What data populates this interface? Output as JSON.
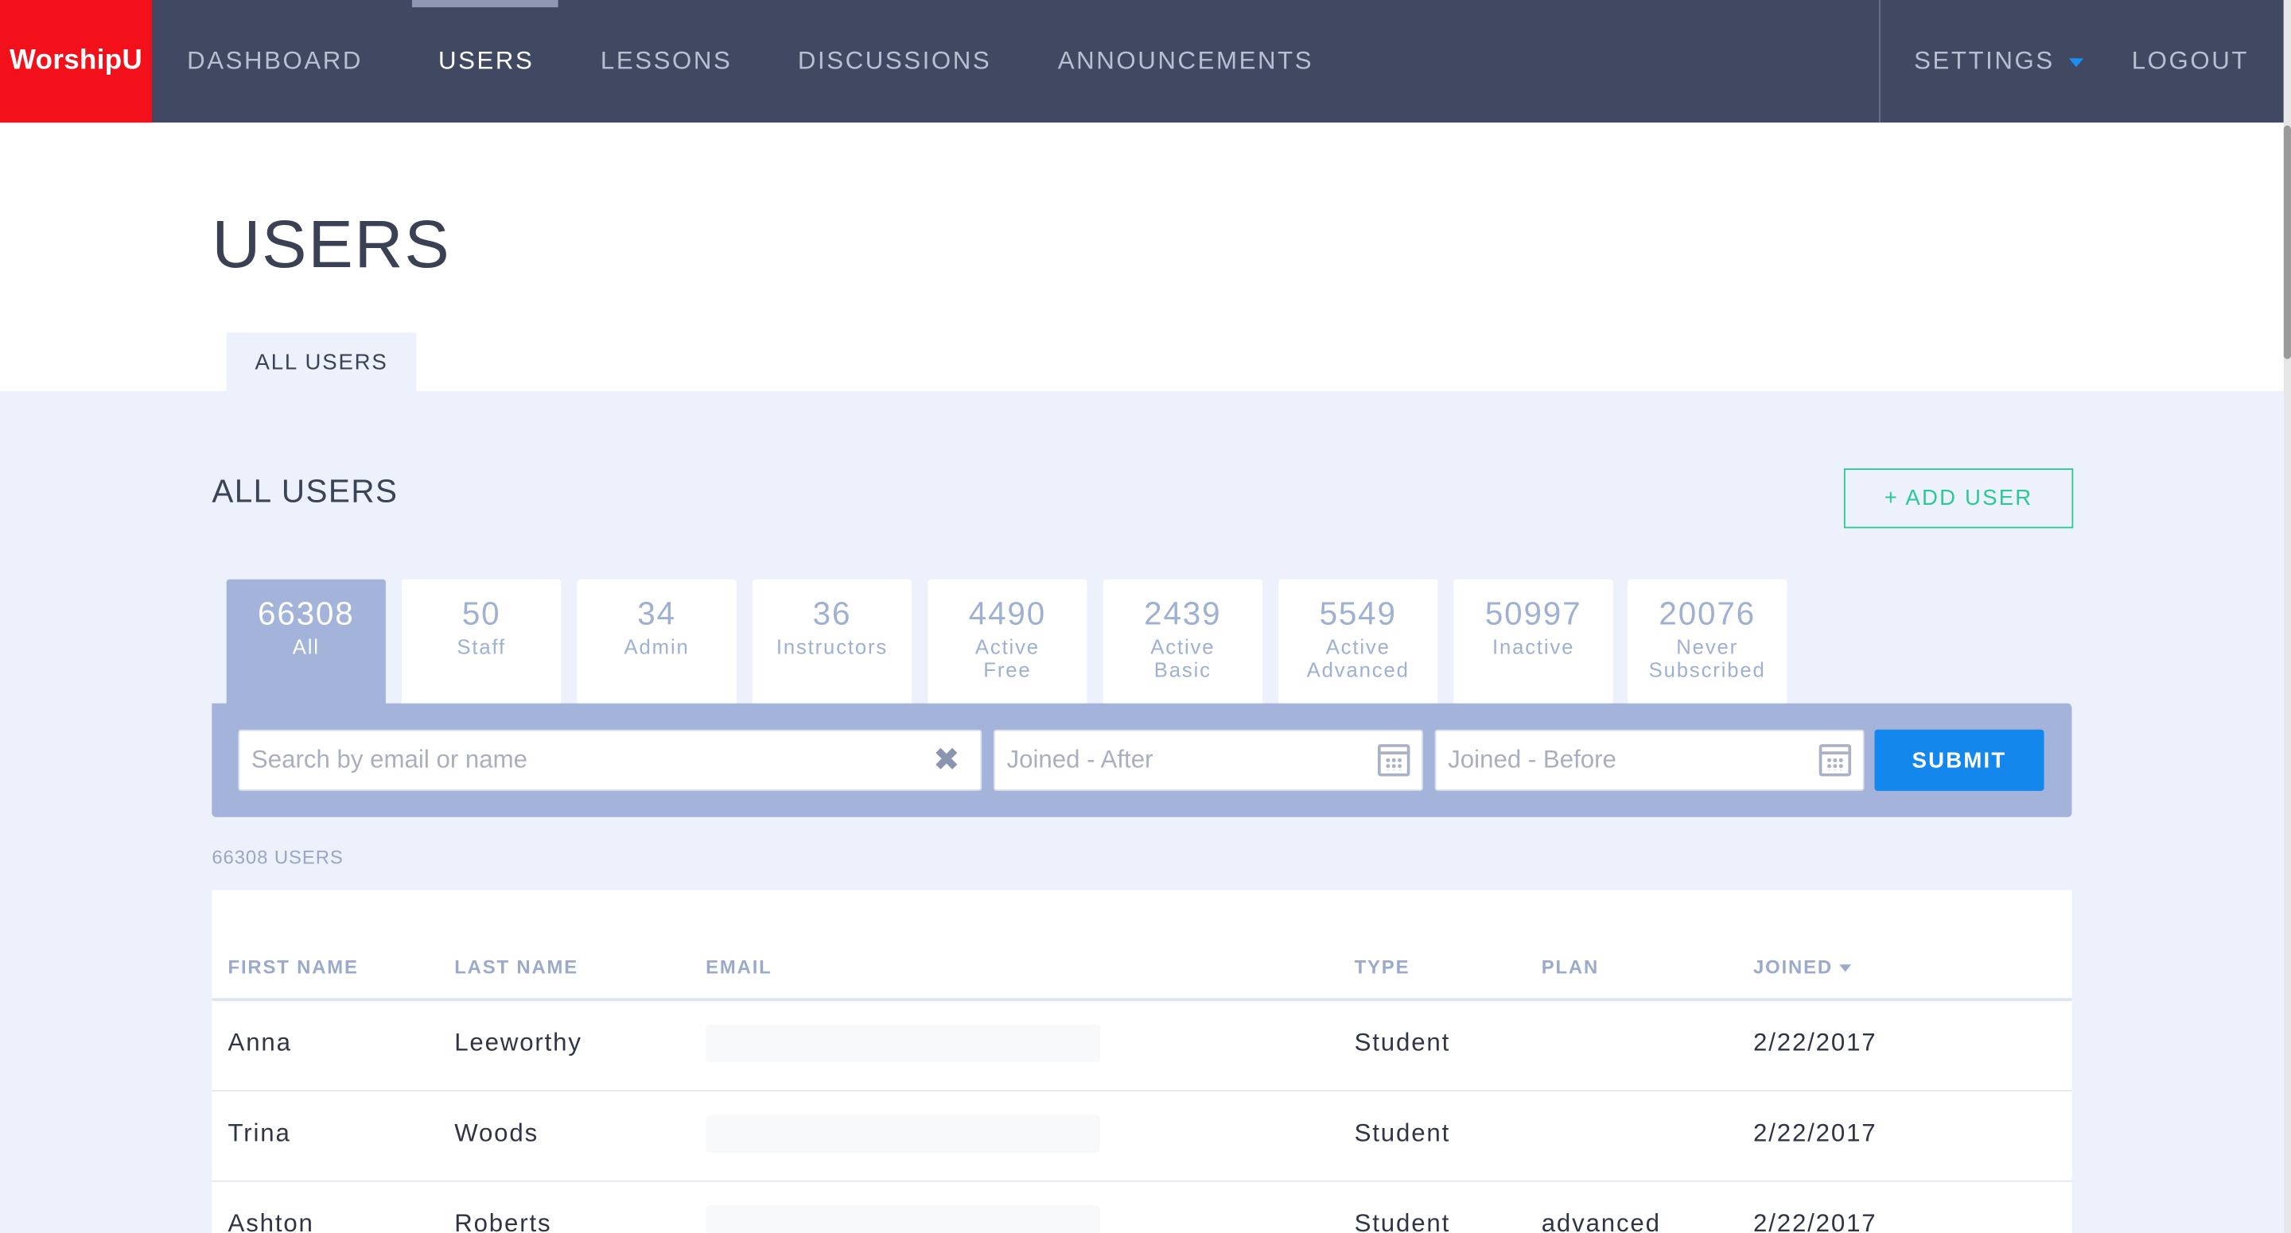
{
  "brand": "WorshipU",
  "nav": {
    "items": [
      {
        "label": "DASHBOARD"
      },
      {
        "label": "USERS"
      },
      {
        "label": "LESSONS"
      },
      {
        "label": "DISCUSSIONS"
      },
      {
        "label": "ANNOUNCEMENTS"
      }
    ],
    "active": "USERS",
    "settings": "SETTINGS",
    "logout": "LOGOUT",
    "accent_color": "#1b8ef2",
    "bg_color": "#414862"
  },
  "page": {
    "title": "USERS",
    "subtab": "ALL USERS",
    "section_title": "ALL USERS",
    "add_user": "+ ADD USER"
  },
  "filter_tabs": [
    {
      "count": "66308",
      "label": "All"
    },
    {
      "count": "50",
      "label": "Staff"
    },
    {
      "count": "34",
      "label": "Admin"
    },
    {
      "count": "36",
      "label": "Instructors"
    },
    {
      "count": "4490",
      "label": "Active Free"
    },
    {
      "count": "2439",
      "label": "Active Basic"
    },
    {
      "count": "5549",
      "label": "Active Advanced"
    },
    {
      "count": "50997",
      "label": "Inactive"
    },
    {
      "count": "20076",
      "label": "Never Subscribed"
    }
  ],
  "search": {
    "placeholder": "Search by email or name",
    "joined_after_placeholder": "Joined - After",
    "joined_before_placeholder": "Joined - Before",
    "submit": "SUBMIT",
    "clear_icon": "close-icon",
    "calendar_icon": "calendar-icon"
  },
  "users_count_label": "66308 USERS",
  "table": {
    "columns": [
      "FIRST NAME",
      "LAST NAME",
      "EMAIL",
      "TYPE",
      "PLAN",
      "JOINED"
    ],
    "sorted_by": "JOINED",
    "rows": [
      {
        "first": "Anna",
        "last": "Leeworthy",
        "email": "",
        "type": "Student",
        "plan": "",
        "joined": "2/22/2017"
      },
      {
        "first": "Trina",
        "last": "Woods",
        "email": "",
        "type": "Student",
        "plan": "",
        "joined": "2/22/2017"
      },
      {
        "first": "Ashton",
        "last": "Roberts",
        "email": "",
        "type": "Student",
        "plan": "advanced",
        "joined": "2/22/2017"
      }
    ]
  }
}
